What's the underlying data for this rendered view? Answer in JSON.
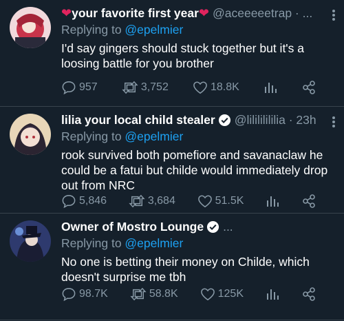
{
  "tweets": [
    {
      "name": "your favorite first year",
      "handle": "@aceeeeetrap · ...",
      "replying_to_prefix": "Replying to ",
      "replying_to": "@epelmier",
      "text": "I'd say gingers should stuck together but it's a loosing battle for you brother",
      "replies": "957",
      "retweets": "3,752",
      "likes": "18.8K"
    },
    {
      "name": "lilia your local child stealer",
      "handle": "@lilililililia · 23h",
      "replying_to_prefix": "Replying to ",
      "replying_to": "@epelmier",
      "text": "rook survived both pomefiore and savanaclaw he could be a fatui but childe would immediately drop out from NRC",
      "replies": "5,846",
      "retweets": "3,684",
      "likes": "51.5K"
    },
    {
      "name": "Owner of Mostro Lounge",
      "handle": "...",
      "replying_to_prefix": "Replying to ",
      "replying_to": "@epelmier",
      "text": "No one is betting their money on Childe, which doesn't surprise me tbh",
      "replies": "98.7K",
      "retweets": "58.8K",
      "likes": "125K"
    }
  ],
  "heart_emoji": "❤",
  "colors": {
    "background": "#15202b",
    "muted": "#8899a6",
    "link": "#1da1f2",
    "heart": "#e0245e",
    "divider": "#38444d"
  }
}
